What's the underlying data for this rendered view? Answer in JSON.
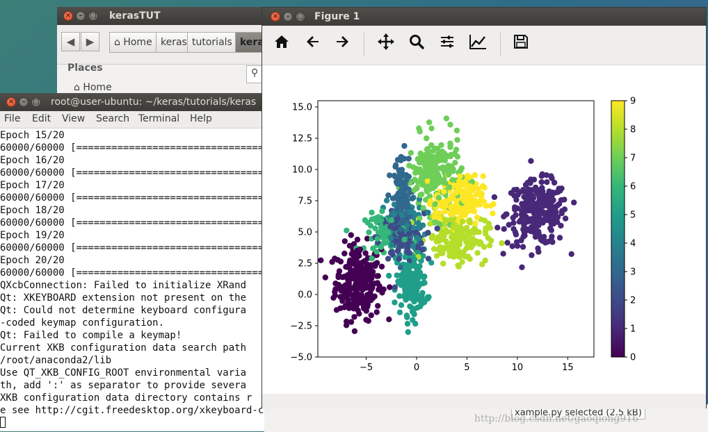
{
  "file_manager": {
    "title": "kerasTUT",
    "breadcrumbs": [
      "Home",
      "keras",
      "tutorials",
      "keras"
    ],
    "sidebar_heading": "Places",
    "sidebar_home": "Home",
    "status_selected": "xample.py  selected  (2.5 kB)"
  },
  "terminal": {
    "title": "root@user-ubuntu: ~/keras/tutorials/keras",
    "menu": [
      "File",
      "Edit",
      "View",
      "Search",
      "Terminal",
      "Help"
    ],
    "lines": [
      "Epoch 15/20",
      "60000/60000 [=================================",
      "Epoch 16/20",
      "60000/60000 [=================================",
      "Epoch 17/20",
      "60000/60000 [=================================",
      "Epoch 18/20",
      "60000/60000 [=================================",
      "Epoch 19/20",
      "60000/60000 [=================================",
      "Epoch 20/20",
      "60000/60000 [=================================",
      "QXcbConnection: Failed to initialize XRand",
      "Qt: XKEYBOARD extension not present on the",
      "Qt: Could not determine keyboard configura",
      "-coded keymap configuration.",
      "Qt: Failed to compile a keymap!",
      "Current XKB configuration data search path",
      "/root/anaconda2/lib",
      "Use QT_XKB_CONFIG_ROOT environmental varia",
      "th, add ':' as separator to provide severa",
      "XKB configuration data directory contains r",
      "e see http://cgit.freedesktop.org/xkeyboard-config/ ."
    ]
  },
  "watermark": "http://blog.csdn.net/gaoqiong916",
  "figure": {
    "title": "Figure 1",
    "toolbar": [
      "home-icon",
      "back-arrow-icon",
      "forward-arrow-icon",
      "pan-icon",
      "zoom-icon",
      "subplots-icon",
      "edit-axis-icon",
      "save-icon"
    ]
  },
  "chart_data": {
    "type": "scatter",
    "title": "",
    "xlabel": "",
    "ylabel": "",
    "xlim": [
      -9.8,
      17.6
    ],
    "ylim": [
      -5,
      15.5
    ],
    "xticks": [
      -5,
      0,
      5,
      10,
      15
    ],
    "yticks": [
      -5.0,
      -2.5,
      0.0,
      2.5,
      5.0,
      7.5,
      10.0,
      12.5,
      15.0
    ],
    "colorbar": {
      "min": 0,
      "max": 9,
      "ticks": [
        0,
        1,
        2,
        3,
        4,
        5,
        6,
        7,
        8,
        9
      ],
      "colormap": "viridis"
    },
    "clusters": [
      {
        "label": 0,
        "center": [
          -5.8,
          1.0
        ],
        "spread": [
          1.5,
          2.0
        ],
        "n": 260
      },
      {
        "label": 1,
        "center": [
          12.0,
          6.5
        ],
        "spread": [
          2.0,
          1.7
        ],
        "n": 260
      },
      {
        "label": 2,
        "center": [
          -1.5,
          4.5
        ],
        "spread": [
          1.5,
          1.3
        ],
        "n": 110
      },
      {
        "label": 3,
        "center": [
          -1.5,
          7.5
        ],
        "spread": [
          0.6,
          2.5
        ],
        "n": 150
      },
      {
        "label": 4,
        "center": [
          -1.2,
          5.5
        ],
        "spread": [
          1.4,
          1.4
        ],
        "n": 90
      },
      {
        "label": 5,
        "center": [
          -0.5,
          1.0
        ],
        "spread": [
          1.0,
          1.7
        ],
        "n": 170
      },
      {
        "label": 6,
        "center": [
          -3.0,
          5.0
        ],
        "spread": [
          1.4,
          1.0
        ],
        "n": 70
      },
      {
        "label": 7,
        "center": [
          1.8,
          9.5
        ],
        "spread": [
          1.8,
          2.1
        ],
        "n": 210
      },
      {
        "label": 8,
        "center": [
          4.0,
          4.5
        ],
        "spread": [
          2.0,
          1.3
        ],
        "n": 170
      },
      {
        "label": 9,
        "center": [
          4.2,
          7.5
        ],
        "spread": [
          1.6,
          1.3
        ],
        "n": 170
      }
    ]
  }
}
